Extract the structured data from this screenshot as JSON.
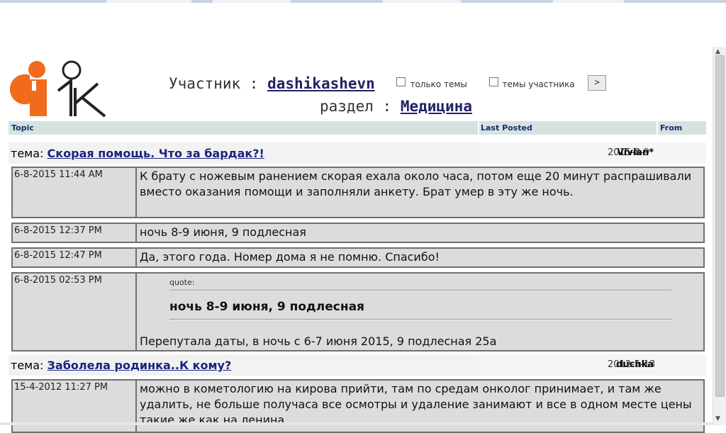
{
  "header": {
    "member_label": "Участник :",
    "member_name": "dashikashevn",
    "option_topics_only": "только темы",
    "option_member_topics": "темы участника",
    "go_button": ">",
    "section_label": "раздел :",
    "section_name": "Медицина"
  },
  "table_head": {
    "topic": "Topic",
    "last_posted": "Last Posted",
    "from": "From"
  },
  "topics": [
    {
      "prefix": "тема:",
      "title": "Скорая помощь. Что за бардак?!",
      "author": "Vivian*",
      "date": "2015-8-9",
      "posts": [
        {
          "date": "6-8-2015 11:44 AM",
          "text": "К брату с ножевым ранением скорая ехала около часа, потом еще 20 минут распрашивали вместо оказания помощи и заполняли анкету. Брат умер в эту же ночь."
        },
        {
          "date": "6-8-2015 12:37 PM",
          "text": "ночь 8-9 июня, 9 подлесная"
        },
        {
          "date": "6-8-2015 12:47 PM",
          "text": "Да, этого года. Номер дома я не помню. Спасибо!"
        },
        {
          "date": "6-8-2015 02:53 PM",
          "quote_label": "quote:",
          "quote": "ночь 8-9 июня, 9 подлесная",
          "text": "Перепутала даты, в ночь с 6-7 июня 2015, 9 подлесная 25а"
        }
      ]
    },
    {
      "prefix": "тема:",
      "title": "Заболела родинка..К кому?",
      "author": "duchka",
      "date": "2012-5-13",
      "posts": [
        {
          "date": "15-4-2012 11:27 PM",
          "text": "можно в кометологию на кирова прийти, там по средам онколог принимает, и там же удалить, не больше получаса все осмотры и удаление занимают и все в одном месте цены такие же как на ленина"
        }
      ]
    }
  ],
  "colors": {
    "link": "#1a237e",
    "header_bg": "#d4e3e0",
    "logo_orange": "#f26b1d",
    "post_bg": "#dcdcdc"
  },
  "icons": {
    "logo": "site-logo-icon"
  }
}
